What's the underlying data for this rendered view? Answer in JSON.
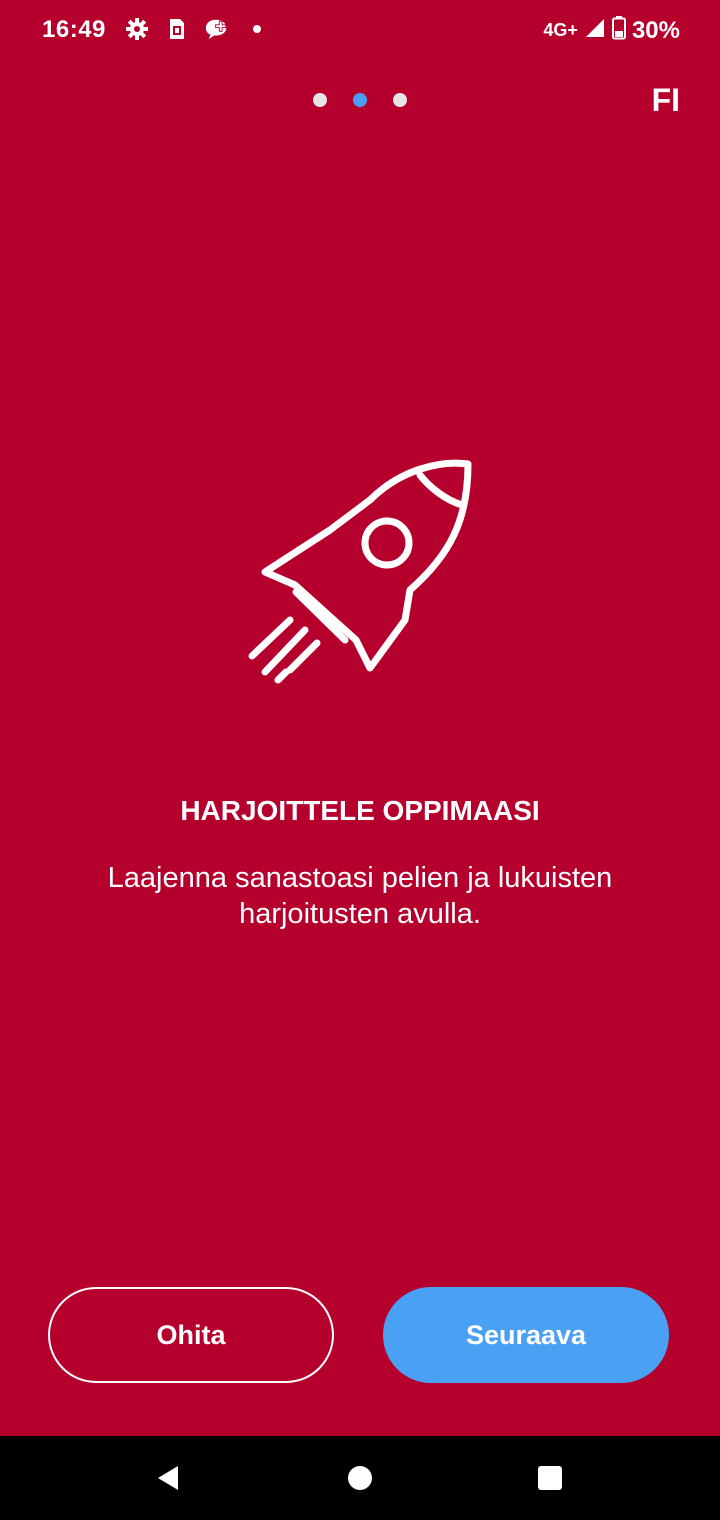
{
  "status_bar": {
    "time": "16:49",
    "left_icons": [
      "settings-icon",
      "sim-card-icon",
      "chat-plus-icon",
      "notification-dot-icon"
    ],
    "network": "4G+",
    "battery": "30%"
  },
  "pager": {
    "pages": 3,
    "active_index": 1
  },
  "language_label": "FI",
  "hero_icon": "rocket-icon",
  "content": {
    "title": "HARJOITTELE OPPIMAASI",
    "description": "Laajenna sanastoasi pelien ja lukuisten harjoitusten avulla."
  },
  "buttons": {
    "skip_label": "Ohita",
    "next_label": "Seuraava"
  },
  "colors": {
    "background": "#b5002e",
    "accent": "#4aa1f3",
    "text": "#ffffff"
  },
  "nav_bar": {
    "buttons": [
      "back-icon",
      "home-icon",
      "recents-icon"
    ]
  }
}
